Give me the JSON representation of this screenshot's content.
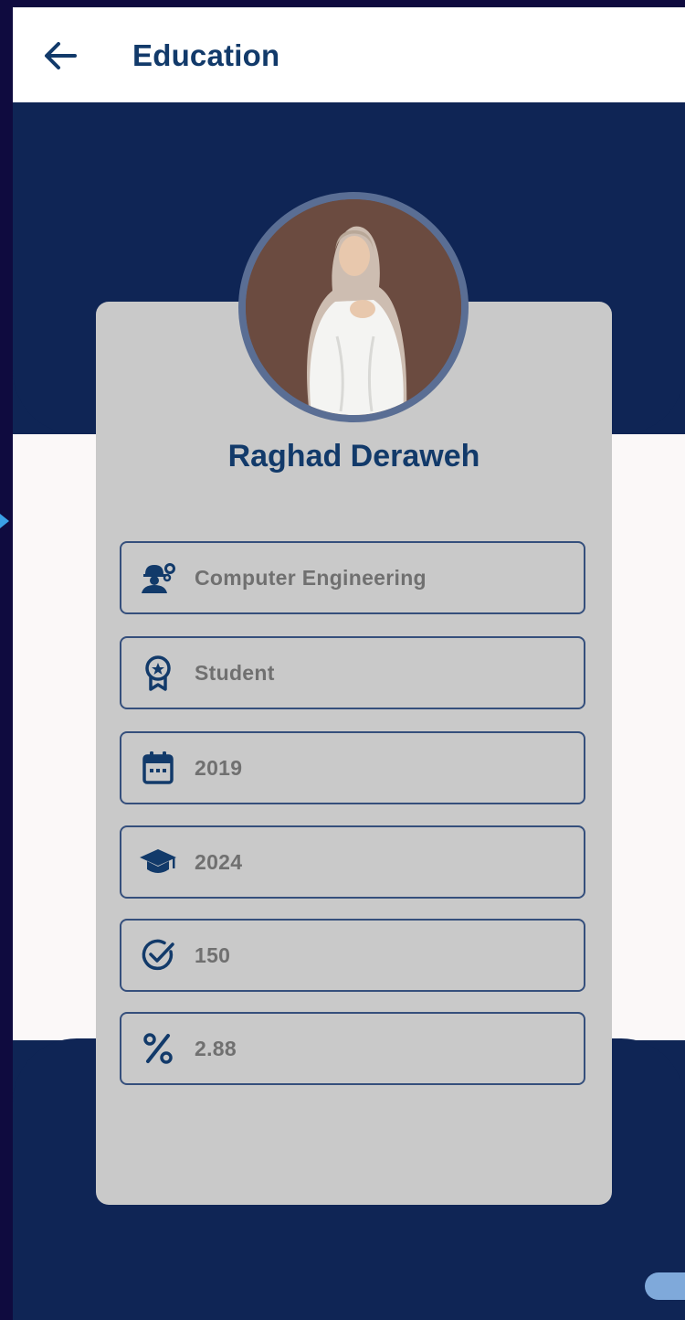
{
  "header": {
    "title": "Education",
    "back_icon": "arrow-left-icon"
  },
  "profile": {
    "name": "Raghad Deraweh"
  },
  "fields": [
    {
      "icon": "engineer-icon",
      "value": "Computer Engineering"
    },
    {
      "icon": "award-badge-icon",
      "value": "Student"
    },
    {
      "icon": "calendar-icon",
      "value": "2019"
    },
    {
      "icon": "graduation-cap-icon",
      "value": "2024"
    },
    {
      "icon": "check-circle-icon",
      "value": "150"
    },
    {
      "icon": "percent-icon",
      "value": "2.88"
    }
  ],
  "colors": {
    "primary": "#0f2555",
    "heading": "#123a6a",
    "card": "#c9c9c9",
    "field_border": "#354f7c",
    "field_text": "#707070"
  }
}
